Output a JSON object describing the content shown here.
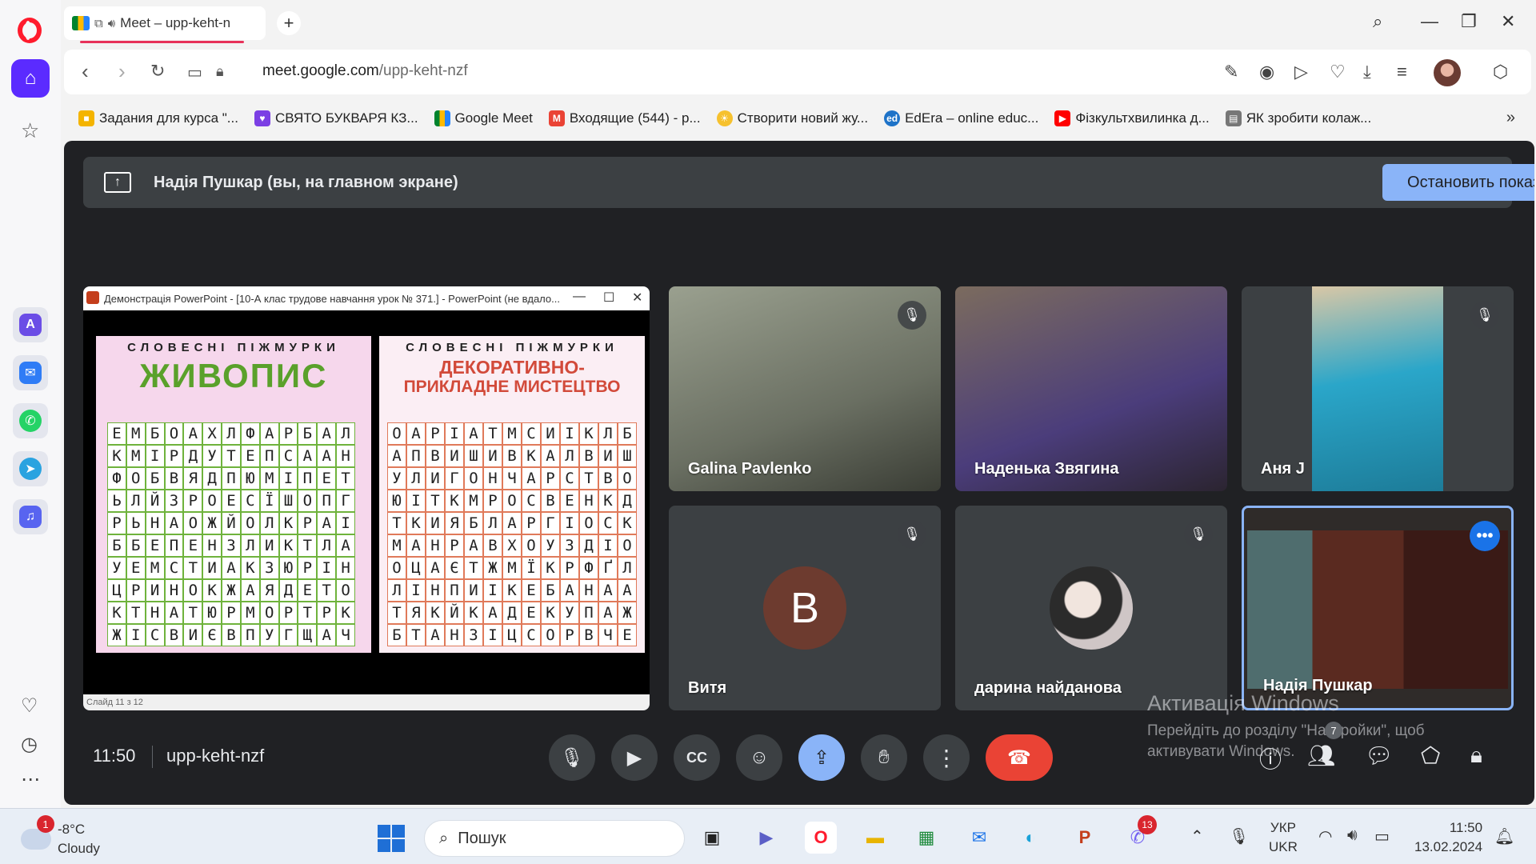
{
  "browser": {
    "tab_title": "Meet – upp-keht-n",
    "url_domain": "meet.google.com",
    "url_path": "/upp-keht-nzf",
    "bookmarks": [
      {
        "label": "Задания для курса \"...",
        "icon": "classroom-icon",
        "color": "#f4b400"
      },
      {
        "label": "СВЯТО БУКВАРЯ КЗ...",
        "icon": "heart-icon",
        "color": "#7b3fe4"
      },
      {
        "label": "Google Meet",
        "icon": "meet-icon",
        "color": "#00832d"
      },
      {
        "label": "Входящие (544) - p...",
        "icon": "gmail-icon",
        "color": "#ea4335"
      },
      {
        "label": "Створити новий жу...",
        "icon": "sun-icon",
        "color": "#f6c12e"
      },
      {
        "label": "EdEra – online educ...",
        "icon": "edera-icon",
        "color": "#1e73c8"
      },
      {
        "label": "Фізкультхвилинка д...",
        "icon": "youtube-icon",
        "color": "#ff0000"
      },
      {
        "label": "ЯК зробити колаж...",
        "icon": "doc-icon",
        "color": "#555555"
      }
    ]
  },
  "meet": {
    "presenting_text": "Надія Пушкар (вы, на главном экране)",
    "stop_button": "Остановить показ",
    "time": "11:50",
    "meeting_code": "upp-keht-nzf",
    "participants_count": "7",
    "presentation": {
      "window_title": "Демонстрація PowerPoint - [10-А клас трудове навчання урок № 371.] - PowerPoint (не вдало...",
      "status": "Слайд 11 з 12",
      "left": {
        "header": "СЛОВЕСНІ ПІЖМУРКИ",
        "title": "ЖИВОПИС",
        "rows": [
          "ЕМБОАХЛФАРБАЛ",
          "КМІРДУТЕПСААН",
          "ФОБВЯДПЮМІПЕТ",
          "ЬЛЙЗРОЕСЇШОПГ",
          "РЬНАОЖЙОЛКРАІ",
          "ББЕПЕНЗЛИКТЛА",
          "УЕМСТИАКЗЮРІН",
          "ЦРИНОКЖАЯДЕТО",
          "КТНАТЮРМОРТРК",
          "ЖІСВИЄВПУГЩАЧ"
        ]
      },
      "right": {
        "header": "СЛОВЕСНІ ПІЖМУРКИ",
        "title_line1": "ДЕКОРАТИВНО-",
        "title_line2": "ПРИКЛАДНЕ МИСТЕЦТВО",
        "rows": [
          "ОАРІАТМСИІКЛБ",
          "АПВИШИВКАЛВИШ",
          "УЛИГОНЧАРСТВО",
          "ЮІТКМРОСВЕНКД",
          "ТКИЯБЛАРГІОСК",
          "МАНРАВХОУЗДІО",
          "ОЦАЄТЖМЇКРФҐЛ",
          "ЛІНПИІКЕБАНАА",
          "ТЯКЙКАДЕКУПАЖ",
          "БТАНЗІЦСОРВЧЕ"
        ]
      }
    },
    "participants": [
      {
        "name": "Galina Pavlenko",
        "muted": true,
        "bg": "#8a8f86"
      },
      {
        "name": "Наденька Звягина",
        "muted": false,
        "bg": "#5b4a6b"
      },
      {
        "name": "Аня J",
        "muted": true,
        "bg": "#3aa5c4"
      },
      {
        "name": "Витя",
        "muted": true,
        "avatar_letter": "В"
      },
      {
        "name": "дарина найданова",
        "muted": true
      },
      {
        "name": "Надія Пушкар",
        "muted": false,
        "bg": "#4a2a22"
      }
    ]
  },
  "activation": {
    "line1": "Активація Windows",
    "line2": "Перейдіть до розділу \"Настройки\", щоб",
    "line3": "активувати Windows."
  },
  "taskbar": {
    "weather_badge": "1",
    "temperature": "-8°C",
    "condition": "Cloudy",
    "search_placeholder": "Пошук",
    "viber_badge": "13",
    "lang_top": "УКР",
    "lang_bottom": "UKR",
    "time": "11:50",
    "date": "13.02.2024"
  }
}
